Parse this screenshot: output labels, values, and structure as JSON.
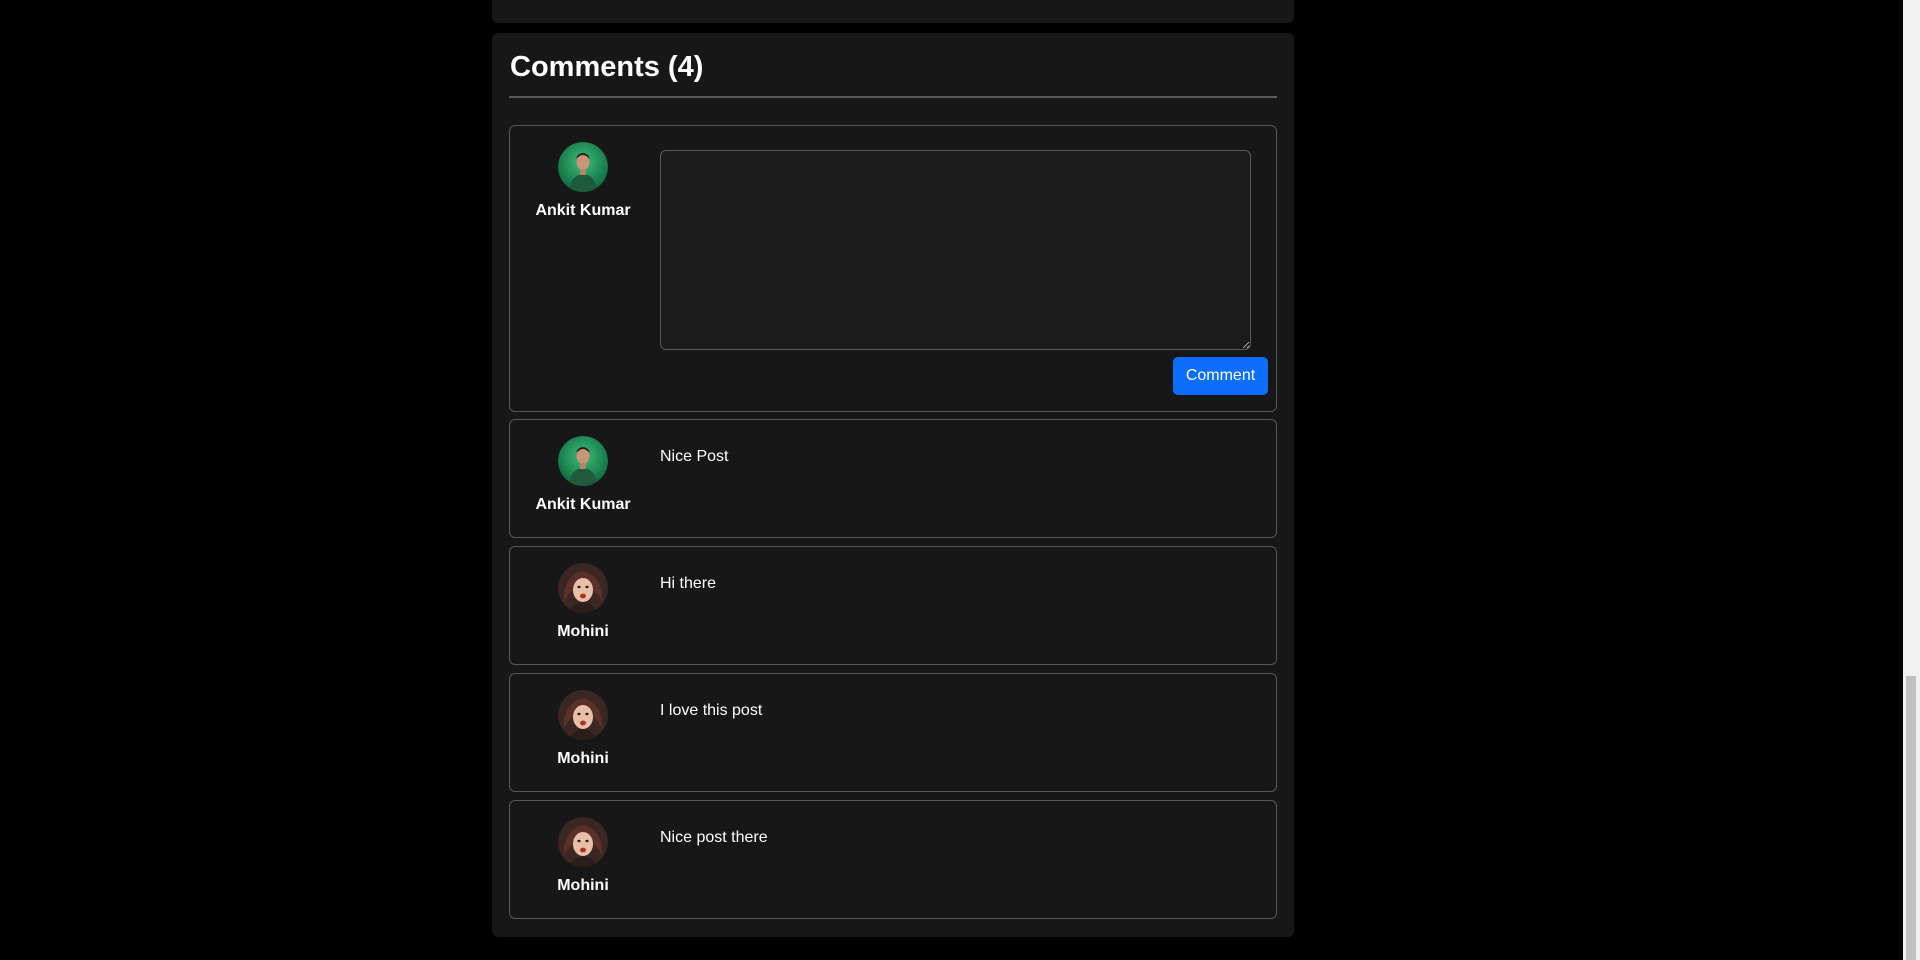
{
  "comments_section": {
    "title": "Comments (4)",
    "new_comment": {
      "author": {
        "name": "Ankit Kumar",
        "avatar": "avatar-ankit"
      },
      "textarea_value": "",
      "submit_label": "Comment"
    },
    "comments": [
      {
        "author": "Ankit Kumar",
        "avatar": "avatar-ankit",
        "text": "Nice Post"
      },
      {
        "author": "Mohini",
        "avatar": "avatar-mohini",
        "text": "Hi there"
      },
      {
        "author": "Mohini",
        "avatar": "avatar-mohini",
        "text": "I love this post"
      },
      {
        "author": "Mohini",
        "avatar": "avatar-mohini",
        "text": "Nice post there"
      }
    ]
  },
  "colors": {
    "page_background": "#000000",
    "card_background": "#171717",
    "border": "#575757",
    "button_primary": "#0d6efd",
    "text": "#ffffff"
  }
}
